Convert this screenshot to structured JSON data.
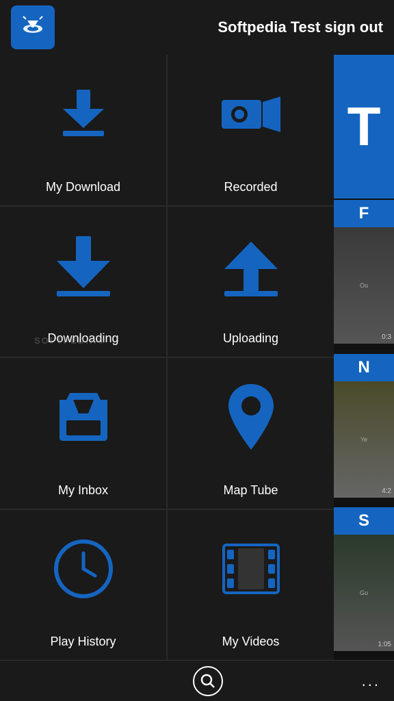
{
  "header": {
    "title": "Softpedia Test",
    "sign_out": "sign out",
    "logo_alt": "app-logo"
  },
  "grid": {
    "items": [
      {
        "id": "my-download",
        "label": "My Download",
        "icon": "download-small"
      },
      {
        "id": "recorded",
        "label": "Recorded",
        "icon": "record-camera"
      },
      {
        "id": "downloading",
        "label": "Downloading",
        "icon": "download-large"
      },
      {
        "id": "uploading",
        "label": "Uploading",
        "icon": "upload-large"
      },
      {
        "id": "my-inbox",
        "label": "My Inbox",
        "icon": "inbox-tray"
      },
      {
        "id": "map-tube",
        "label": "Map Tube",
        "icon": "map-pin"
      },
      {
        "id": "play-history",
        "label": "Play History",
        "icon": "clock"
      },
      {
        "id": "my-videos",
        "label": "My Videos",
        "icon": "film-strip"
      }
    ]
  },
  "sidebar": {
    "top_letter": "T",
    "items": [
      {
        "letter": "F",
        "label": "Ou",
        "duration": "0:3"
      },
      {
        "letter": "N",
        "label": "Ye",
        "duration": "4:2"
      },
      {
        "letter": "S",
        "label": "Gu",
        "duration": "1:05"
      }
    ]
  },
  "bottom_bar": {
    "search_icon": "search",
    "more_label": "..."
  },
  "watermark": "SOFTPEDIA®"
}
